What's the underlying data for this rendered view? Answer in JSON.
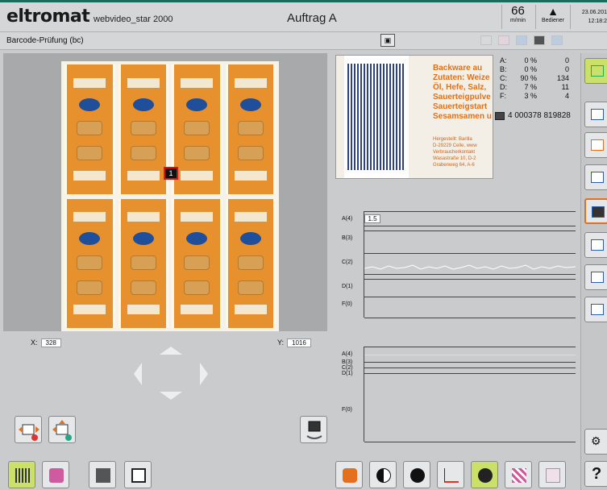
{
  "header": {
    "brand": "eltromat",
    "brand_sub": "webvideo_star 2000",
    "title": "Auftrag A",
    "speed_value": "66",
    "speed_unit": "m/min",
    "user_label": "Bediener",
    "date": "23.06.201",
    "time": "12:18:2"
  },
  "subbar": {
    "mode_label": "Barcode-Prüfung (bc)"
  },
  "viewer": {
    "marker_label": "1",
    "x_label": "X:",
    "x_value": "328",
    "y_label": "Y:",
    "y_value": "1016"
  },
  "preview": {
    "heading_lines": [
      "Backware au",
      "Zutaten: Weize",
      "Öl, Hefe, Salz,",
      "Sauerteigpulve",
      "Sauerteigstart",
      "Sesamsamen u"
    ],
    "footer_lines": [
      "Hergestellt: Barilla",
      "D-29229 Celle, www",
      "Verbraucherkontakt",
      "Wasastraße 10, D-2",
      "Grabenweg 64, A-6"
    ],
    "barcode_digits": "4 000378 819828"
  },
  "stats": [
    {
      "key": "A:",
      "pct": "0 %",
      "val": "0"
    },
    {
      "key": "B:",
      "pct": "0 %",
      "val": "0"
    },
    {
      "key": "C:",
      "pct": "90 %",
      "val": "134"
    },
    {
      "key": "D:",
      "pct": "7 %",
      "val": "11"
    },
    {
      "key": "F:",
      "pct": "3 %",
      "val": "4"
    }
  ],
  "graph_top": {
    "value_box": "1.5",
    "channels": [
      "A(4)",
      "B(3)",
      "C(2)",
      "D(1)",
      "F(0)"
    ]
  },
  "graph_bottom": {
    "channels": [
      "A(4)",
      "B(3)",
      "C(2)",
      "D(1)",
      "F(0)"
    ]
  },
  "colors": {
    "accent": "#e4701e",
    "brand_green": "#1f6a5a",
    "package_orange": "#e6902e",
    "barcode_blue": "#2e3f8e"
  },
  "icons": {
    "right_column": [
      "arrange-icon",
      "monitor-icon",
      "monitor-split-icon",
      "grid-search-icon",
      "camera-barcode-icon",
      "color-layer-icon",
      "print-layer-icon",
      "settings-layer-icon",
      "tools-icon",
      "help-icon"
    ],
    "bottom_left": [
      "barcode-scan-icon",
      "color-picker-icon",
      "camera-grid-icon",
      "window-stack-icon"
    ],
    "bottom_right": [
      "hand-icon",
      "contrast-icon",
      "half-contrast-icon",
      "curve-icon",
      "spot-icon",
      "stripes-icon",
      "adjust-icon"
    ]
  },
  "help_label": "?"
}
